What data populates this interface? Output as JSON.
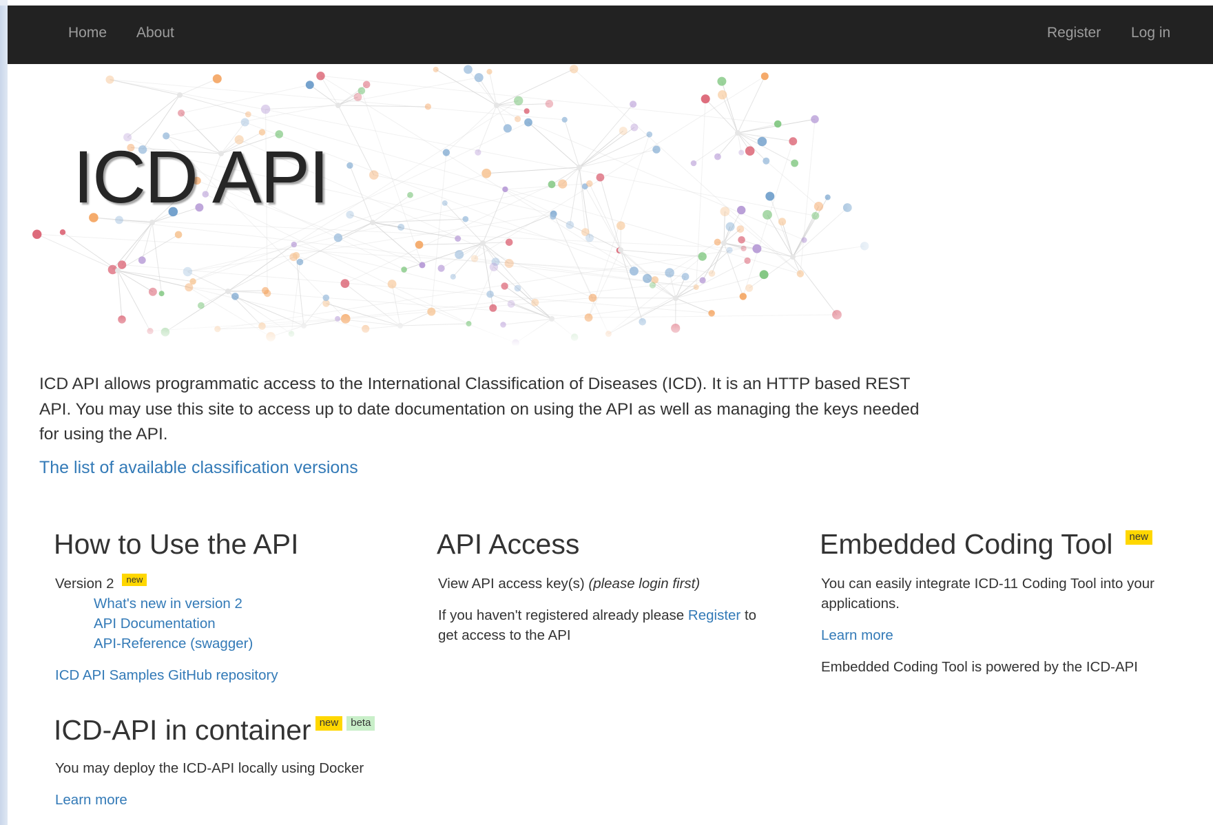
{
  "nav": {
    "home": "Home",
    "about": "About",
    "register": "Register",
    "login": "Log in"
  },
  "hero": {
    "title": "ICD API"
  },
  "intro": {
    "text": "ICD API allows programmatic access to the International Classification of Diseases (ICD). It is an HTTP based REST API. You may use this site to access up to date documentation on using the API as well as managing the keys needed for using the API.",
    "versions_link": "The list of available classification versions"
  },
  "how_to": {
    "title": "How to Use the API",
    "version_label": "Version 2",
    "version_badge": "new",
    "links": [
      "What's new in version 2",
      "API Documentation",
      "API-Reference (swagger)"
    ],
    "samples_link": "ICD API Samples GitHub repository"
  },
  "container": {
    "title": "ICD-API in container",
    "badge_new": "new",
    "badge_beta": "beta",
    "text": "You may deploy the ICD-API locally using Docker",
    "learn_more": "Learn more"
  },
  "access": {
    "title": "API Access",
    "view_keys": "View API access key(s)",
    "login_first": "(please login first)",
    "register_prefix": "If you haven't registered already please",
    "register_link": "Register",
    "register_suffix": "to get access to the API"
  },
  "embedded": {
    "title": "Embedded Coding Tool",
    "badge": "new",
    "text": "You can easily integrate ICD-11 Coding Tool into your applications.",
    "learn_more": "Learn more",
    "powered": "Embedded Coding Tool is powered by the ICD-API"
  },
  "colors": {
    "navbar": "#222222",
    "link": "#337ab7",
    "badge_new": "#ffd700",
    "badge_beta": "#c9efc9"
  }
}
